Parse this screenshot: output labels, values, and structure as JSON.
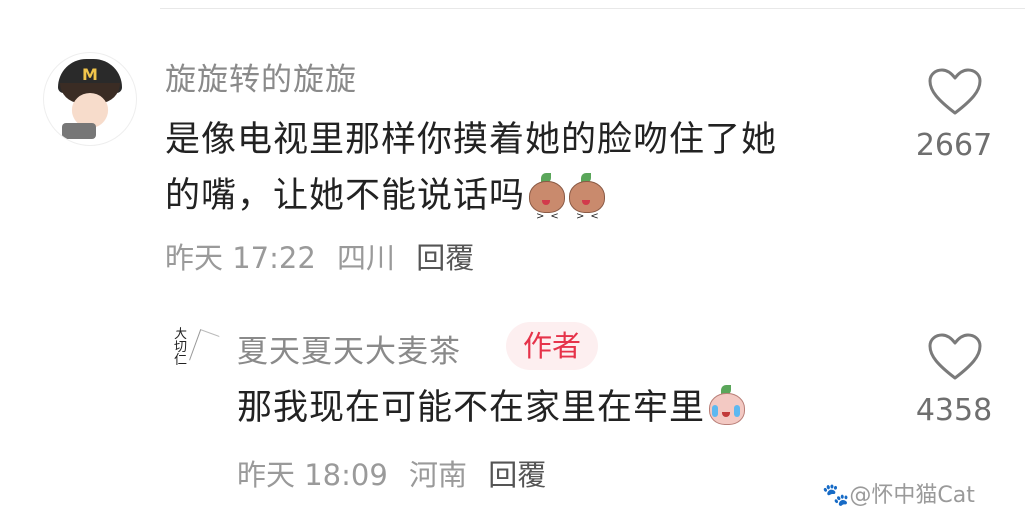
{
  "comments": [
    {
      "username": "旋旋转的旋旋",
      "text_line1": "是像电视里那样你摸着她的脸吻住了她",
      "text_line2": "的嘴，让她不能说话吗",
      "time": "昨天 17:22",
      "location": "四川",
      "reply_label": "回覆",
      "likes": "2667",
      "emoji_icons": [
        "angry-bun-emoji",
        "angry-bun-emoji"
      ]
    },
    {
      "username": "夏天夏天大麦茶",
      "badge": "作者",
      "text": "那我现在可能不在家里在牢里",
      "time": "昨天 18:09",
      "location": "河南",
      "reply_label": "回覆",
      "likes": "4358",
      "emoji_icons": [
        "crying-bun-emoji"
      ]
    }
  ],
  "avatar2_ink": "大\n切\n仁",
  "watermark": "@怀中猫Cat",
  "colors": {
    "author_badge_bg": "#fdeff0",
    "author_badge_text": "#e6334a"
  },
  "icons": {
    "like": "heart-outline-icon",
    "watermark": "paw-icon"
  }
}
